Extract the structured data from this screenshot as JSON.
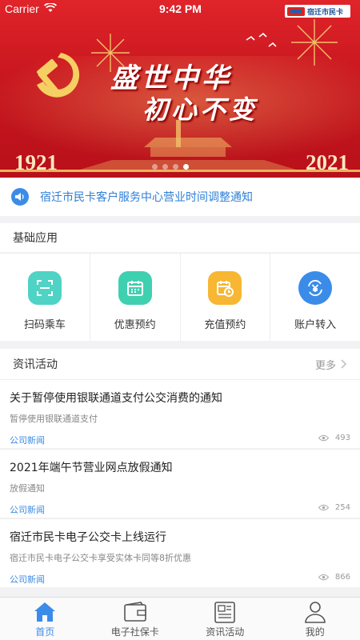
{
  "status_bar": {
    "carrier": "Carrier",
    "time": "9:42 PM",
    "logo_text": "宿迁市民卡"
  },
  "banner": {
    "slogan_line1": "盛世中华",
    "slogan_line2": "初心不变",
    "year_left": "1921",
    "year_right": "2021",
    "active_dot": 3
  },
  "notice": {
    "text": "宿迁市民卡客户服务中心营业时间调整通知"
  },
  "basic_apps": {
    "title": "基础应用",
    "items": [
      {
        "label": "扫码乘车",
        "icon": "scan-icon",
        "color": "#4fd3c4"
      },
      {
        "label": "优惠预约",
        "icon": "calendar-icon",
        "color": "#3fd0b0"
      },
      {
        "label": "充值预约",
        "icon": "calendar-clock-icon",
        "color": "#f7b733"
      },
      {
        "label": "账户转入",
        "icon": "yuan-transfer-icon",
        "color": "#3b8ce8"
      }
    ]
  },
  "news": {
    "title": "资讯活动",
    "more_label": "更多",
    "items": [
      {
        "title": "关于暂停使用银联通道支付公交消费的通知",
        "summary": "暂停使用银联通道支付",
        "category": "公司新闻",
        "views": "493"
      },
      {
        "title": "2021年端午节营业网点放假通知",
        "summary": "放假通知",
        "category": "公司新闻",
        "views": "254"
      },
      {
        "title": "宿迁市民卡电子公交卡上线运行",
        "summary": "宿迁市民卡电子公交卡享受实体卡同等8折优惠",
        "category": "公司新闻",
        "views": "866"
      }
    ]
  },
  "tabbar": {
    "items": [
      {
        "label": "首页",
        "icon": "home-icon",
        "active": true
      },
      {
        "label": "电子社保卡",
        "icon": "card-wallet-icon",
        "active": false
      },
      {
        "label": "资讯活动",
        "icon": "newspaper-icon",
        "active": false
      },
      {
        "label": "我的",
        "icon": "user-icon",
        "active": false
      }
    ]
  },
  "colors": {
    "accent": "#3b8ce8",
    "banner_red": "#c8161f"
  }
}
